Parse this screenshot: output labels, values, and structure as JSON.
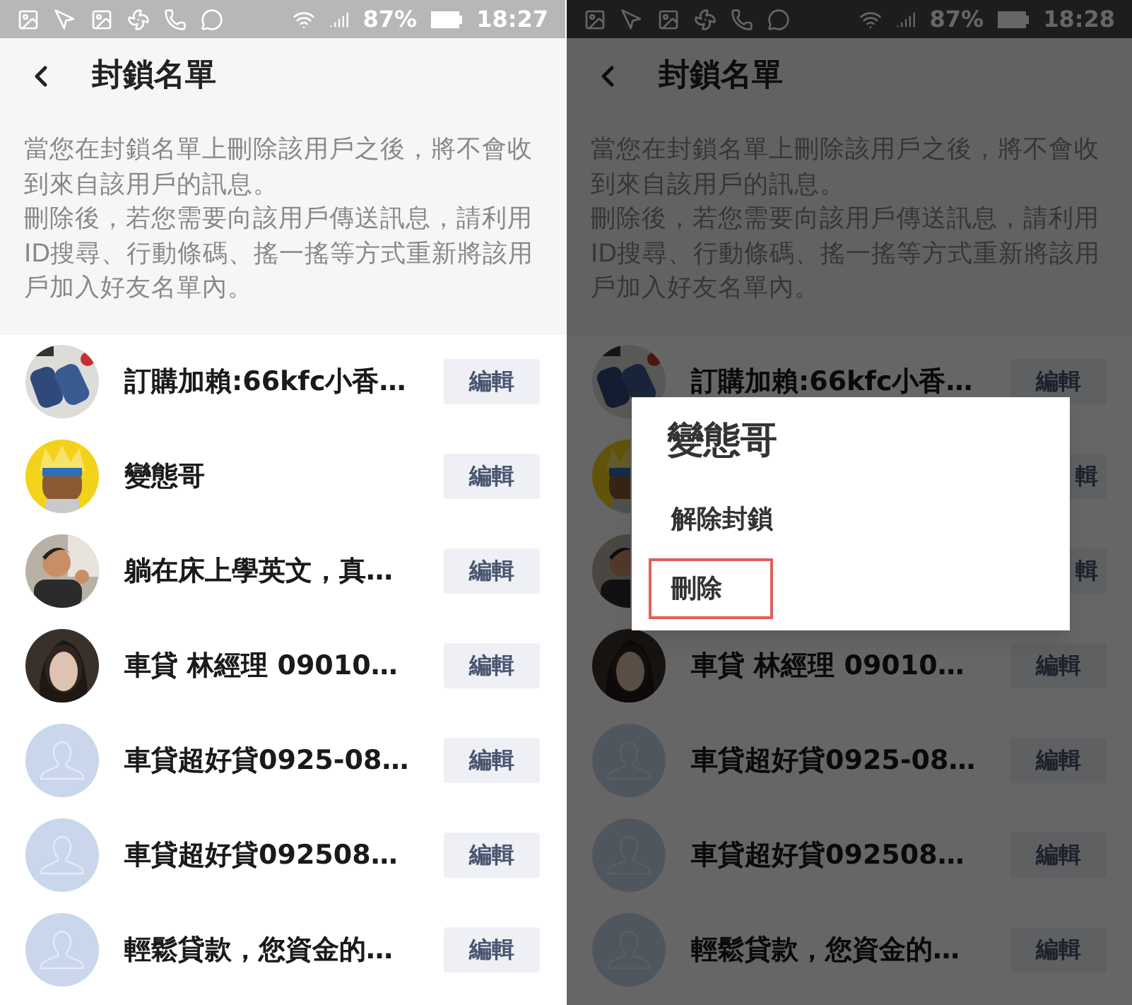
{
  "screens": [
    {
      "status_bar": {
        "battery": "87%",
        "time": "18:27"
      },
      "title": "封鎖名單",
      "dimmed": false,
      "notice": [
        "當您在封鎖名單上刪除該用戶之後，將不會收到來自該用戶的訊息。",
        "刪除後，若您需要向該用戶傳送訊息，請利用ID搜尋、行動條碼、搖一搖等方式重新將該用戶加入好友名單內。"
      ],
      "contacts": [
        {
          "name": "訂購加賴:66kfc小香…",
          "kind": "picture",
          "action": "編輯"
        },
        {
          "name": "變態哥",
          "kind": "picture",
          "action": "編輯"
        },
        {
          "name": "躺在床上學英文，真…",
          "kind": "picture",
          "action": "編輯"
        },
        {
          "name": "車貸 林經理 09010…",
          "kind": "picture",
          "action": "編輯"
        },
        {
          "name": "車貸超好貸0925-08…",
          "kind": "placeholder",
          "action": "編輯"
        },
        {
          "name": "車貸超好貸092508…",
          "kind": "placeholder",
          "action": "編輯"
        },
        {
          "name": "輕鬆貸款，您資金的…",
          "kind": "placeholder",
          "action": "編輯"
        }
      ]
    },
    {
      "status_bar": {
        "battery": "87%",
        "time": "18:28"
      },
      "title": "封鎖名單",
      "dimmed": true,
      "notice": [
        "當您在封鎖名單上刪除該用戶之後，將不會收到來自該用戶的訊息。",
        "刪除後，若您需要向該用戶傳送訊息，請利用ID搜尋、行動條碼、搖一搖等方式重新將該用戶加入好友名單內。"
      ],
      "contacts": [
        {
          "name": "訂購加賴:66kfc小香…",
          "kind": "picture",
          "action": "編輯"
        },
        {
          "kind": "picture",
          "action": "輯"
        },
        {
          "kind": "picture",
          "action": "輯"
        },
        {
          "name": "車貸 林經理 09010…",
          "kind": "picture",
          "action": "編輯"
        },
        {
          "name": "車貸超好貸0925-08…",
          "kind": "placeholder",
          "action": "編輯"
        },
        {
          "name": "車貸超好貸092508…",
          "kind": "placeholder",
          "action": "編輯"
        },
        {
          "name": "輕鬆貸款，您資金的…",
          "kind": "placeholder",
          "action": "編輯"
        }
      ],
      "dialog": {
        "title": "變態哥",
        "options": [
          {
            "label": "解除封鎖",
            "highlighted": false
          },
          {
            "label": "刪除",
            "highlighted": true
          }
        ]
      }
    }
  ]
}
